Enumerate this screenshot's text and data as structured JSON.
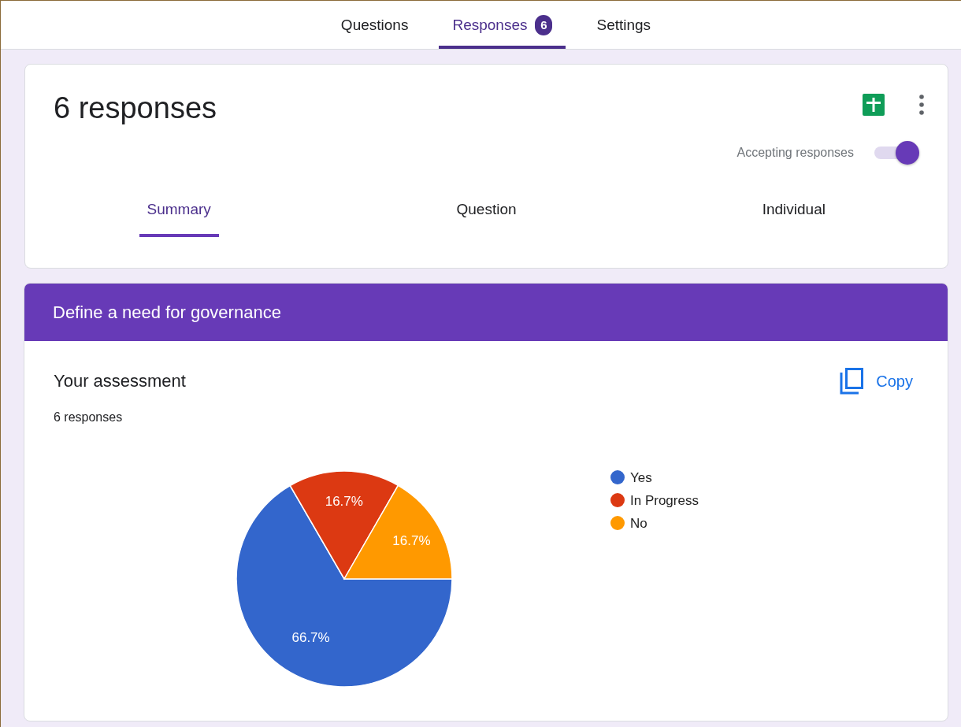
{
  "top_tabs": [
    {
      "label": "Questions",
      "selected": false
    },
    {
      "label": "Responses",
      "selected": true,
      "badge": "6"
    },
    {
      "label": "Settings",
      "selected": false
    }
  ],
  "summary_card": {
    "title": "6 responses",
    "accepting": {
      "label": "Accepting responses",
      "on": true
    },
    "view_tabs": [
      {
        "label": "Summary",
        "selected": true
      },
      {
        "label": "Question",
        "selected": false
      },
      {
        "label": "Individual",
        "selected": false
      }
    ]
  },
  "section": {
    "title": "Define a need for governance"
  },
  "question": {
    "title": "Your assessment",
    "count": "6 responses",
    "copy_label": "Copy",
    "chart_data": {
      "type": "pie",
      "categories": [
        "Yes",
        "In Progress",
        "No"
      ],
      "values": [
        66.7,
        16.7,
        16.7
      ],
      "legend": true,
      "value_labels": [
        "66.7%",
        "16.7%",
        "16.7%"
      ],
      "colors": [
        "#3366cc",
        "#dc3912",
        "#ff9900"
      ]
    }
  }
}
